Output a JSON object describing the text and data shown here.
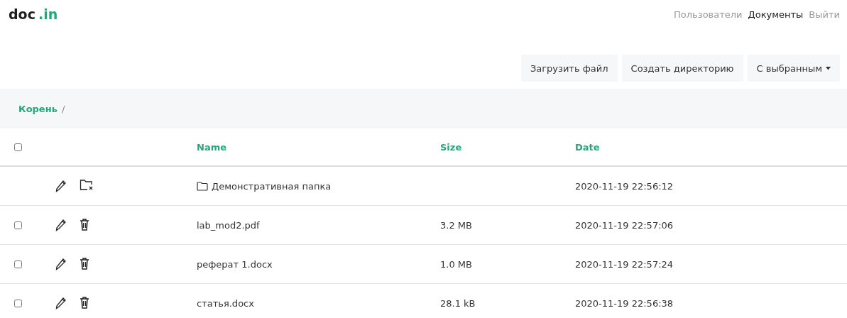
{
  "logo": {
    "main": "doc",
    "accent": ".in"
  },
  "nav": [
    {
      "label": "Пользователи",
      "selected": false
    },
    {
      "label": "Документы",
      "selected": true
    },
    {
      "label": "Выйти",
      "selected": false
    }
  ],
  "toolbar": {
    "buttons": [
      {
        "label": "Загрузить файл",
        "kind": "plain"
      },
      {
        "label": "Создать директорию",
        "kind": "plain"
      },
      {
        "label": "С выбранным",
        "kind": "dropdown"
      }
    ]
  },
  "breadcrumb": [
    {
      "label": "Корень",
      "separator": "/"
    }
  ],
  "table": {
    "select_all_checked": false,
    "columns": [
      "Name",
      "Size",
      "Date"
    ],
    "rows": [
      {
        "kind": "folder",
        "name": "Демонстративная папка",
        "date": "2020-11-19 22:56:12"
      },
      {
        "kind": "file",
        "checked": false,
        "name": "lab_mod2.pdf",
        "size": "3.2 MB",
        "date": "2020-11-19 22:57:06"
      },
      {
        "kind": "file",
        "checked": false,
        "name": "реферат 1.docx",
        "size": "1.0 MB",
        "date": "2020-11-19 22:57:24"
      },
      {
        "kind": "file",
        "checked": false,
        "name": "статья.docx",
        "size": "28.1 kB",
        "date": "2020-11-19 22:56:38"
      }
    ]
  }
}
